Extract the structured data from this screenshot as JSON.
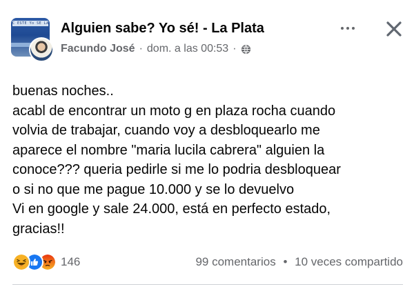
{
  "post": {
    "group_name": "Alguien sabe? Yo sé! - La Plata",
    "group_avatar_text": "C ESTE Yo SE LA",
    "author": "Facundo José",
    "separator": "·",
    "timestamp": "dom. a las 00:53",
    "privacy_icon": "globe-icon",
    "more_icon": "more-horizontal-icon",
    "close_icon": "close-icon",
    "body": "buenas noches..\n acabl de encontrar un moto g en plaza rocha cuando\nvolvia de trabajar, cuando voy a desbloquearlo me\naparece el nombre \"maria lucila cabrera\" alguien la\nconoce??? queria pedirle si me lo podria desbloquear\no si no que me pague 10.000 y se lo devuelvo\nVi en google y sale 24.000, está en perfecto estado,\ngracias!!"
  },
  "footer": {
    "reactions": [
      "haha-icon",
      "like-icon",
      "angry-icon"
    ],
    "reaction_count": "146",
    "comments": "99 comentarios",
    "separator": "•",
    "shares": "10 veces compartido"
  },
  "colors": {
    "text": "#050505",
    "secondary": "#65676b",
    "like_blue": "#1877f2",
    "haha_yellow": "#f7b125",
    "angry_red": "#e9710f",
    "divider": "#ced0d4"
  }
}
